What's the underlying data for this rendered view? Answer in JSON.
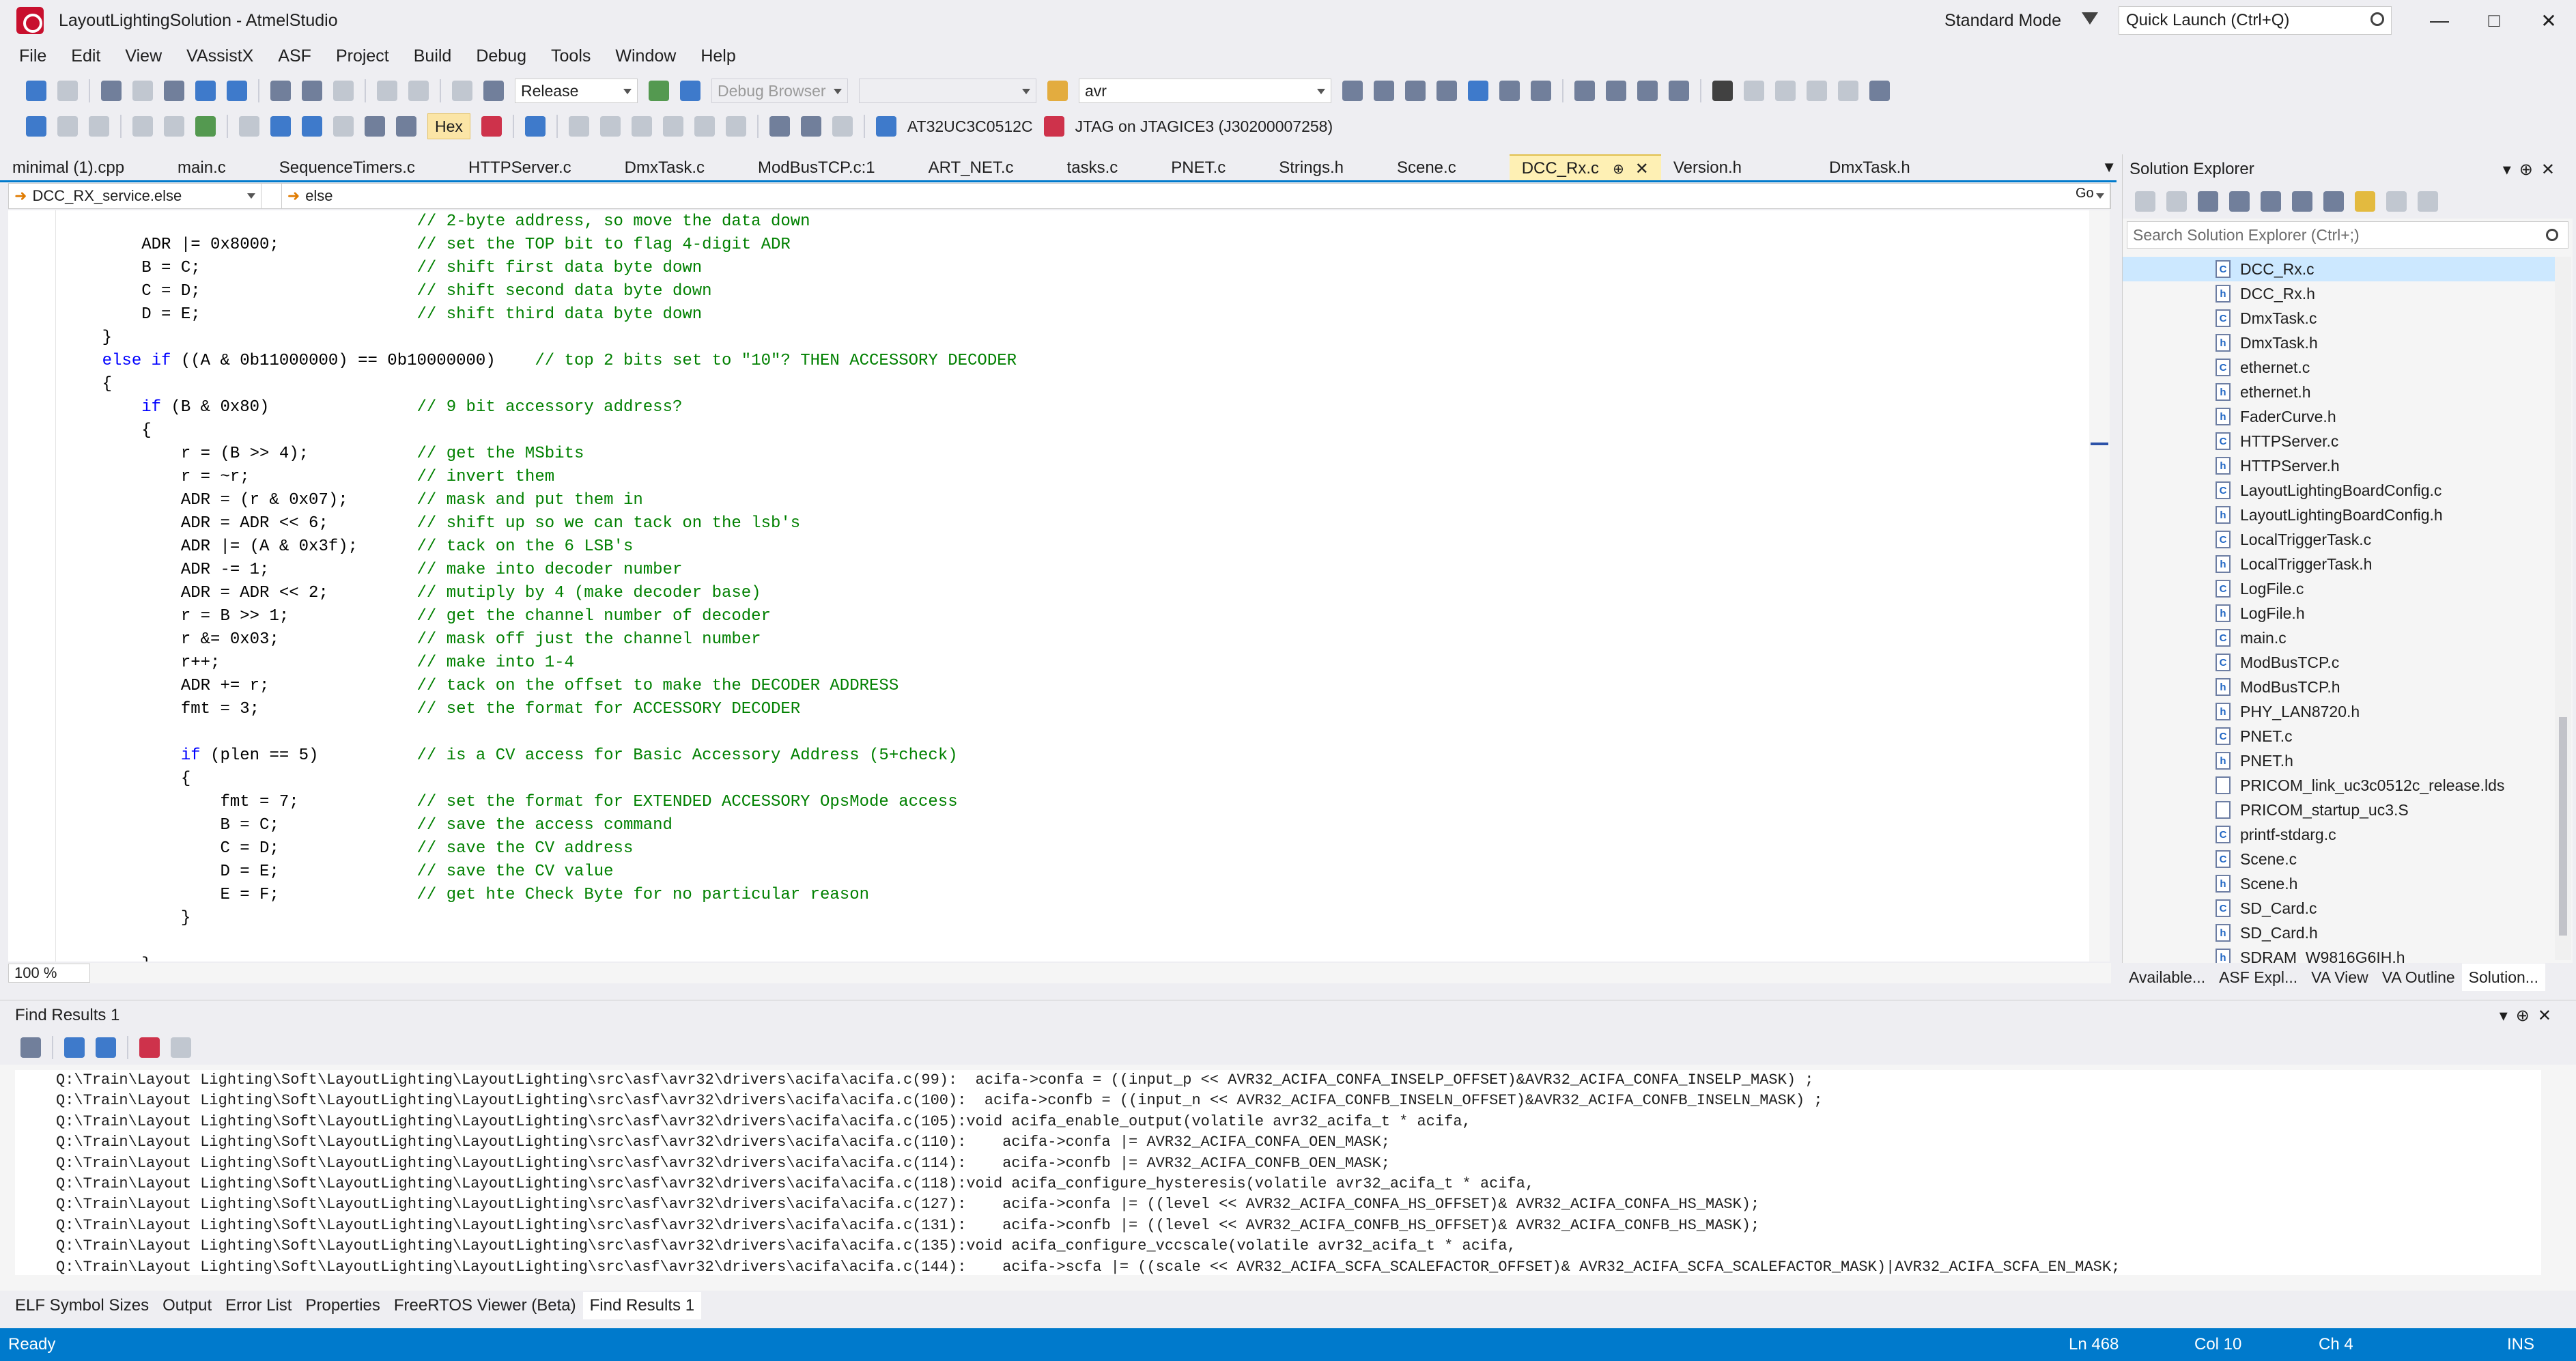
{
  "window": {
    "title": "LayoutLightingSolution - AtmelStudio",
    "mode": "Standard Mode",
    "quick_launch_placeholder": "Quick Launch (Ctrl+Q)"
  },
  "menu": [
    "File",
    "Edit",
    "View",
    "VAssistX",
    "ASF",
    "Project",
    "Build",
    "Debug",
    "Tools",
    "Window",
    "Help"
  ],
  "toolbar": {
    "config": "Release",
    "debug_browser": "Debug Browser",
    "find_combo": "avr",
    "hex": "Hex",
    "device": "AT32UC3C0512C",
    "tool": "JTAG on JTAGICE3 (J30200007258)"
  },
  "doc_tabs": [
    "minimal (1).cpp",
    "main.c",
    "SequenceTimers.c",
    "HTTPServer.c",
    "DmxTask.c",
    "ModBusTCP.c:1",
    "ART_NET.c",
    "tasks.c",
    "PNET.c",
    "Strings.h",
    "Scene.c",
    "DCC_Rx.c",
    "Version.h",
    "DmxTask.h"
  ],
  "active_tab": "DCC_Rx.c",
  "nav": {
    "scope": "DCC_RX_service.else",
    "member": "else",
    "go": "Go"
  },
  "code_lines": [
    {
      "c": "",
      "m": "// 2-byte address, so move the data down"
    },
    {
      "c": "        ADR |= 0x8000;",
      "m": "// set the TOP bit to flag 4-digit ADR"
    },
    {
      "c": "        B = C;",
      "m": "// shift first data byte down"
    },
    {
      "c": "        C = D;",
      "m": "// shift second data byte down"
    },
    {
      "c": "        D = E;",
      "m": "// shift third data byte down"
    },
    {
      "c": "    }",
      "m": ""
    },
    {
      "k": "    else if",
      "c": " ((A & 0b11000000) == 0b10000000)",
      "m": "    // top 2 bits set to \"10\"? THEN ACCESSORY DECODER"
    },
    {
      "c": "    {",
      "m": ""
    },
    {
      "k": "        if",
      "c": " (B & 0x80)",
      "m": "// 9 bit accessory address?"
    },
    {
      "c": "        {",
      "m": ""
    },
    {
      "c": "            r = (B >> 4);",
      "m": "// get the MSbits"
    },
    {
      "c": "            r = ~r;",
      "m": "// invert them"
    },
    {
      "c": "            ADR = (r & 0x07);",
      "m": "// mask and put them in"
    },
    {
      "c": "            ADR = ADR << 6;",
      "m": "// shift up so we can tack on the lsb's"
    },
    {
      "c": "            ADR |= (A & 0x3f);",
      "m": "// tack on the 6 LSB's"
    },
    {
      "c": "            ADR -= 1;",
      "m": "// make into decoder number"
    },
    {
      "c": "            ADR = ADR << 2;",
      "m": "// mutiply by 4 (make decoder base)"
    },
    {
      "c": "            r = B >> 1;",
      "m": "// get the channel number of decoder"
    },
    {
      "c": "            r &= 0x03;",
      "m": "// mask off just the channel number"
    },
    {
      "c": "            r++;",
      "m": "// make into 1-4"
    },
    {
      "c": "            ADR += r;",
      "m": "// tack on the offset to make the DECODER ADDRESS"
    },
    {
      "c": "            fmt = 3;",
      "m": "// set the format for ACCESSORY DECODER"
    },
    {
      "c": "",
      "m": ""
    },
    {
      "k": "            if",
      "c": " (plen == 5)",
      "m": "// is a CV access for Basic Accessory Address (5+check)"
    },
    {
      "c": "            {",
      "m": ""
    },
    {
      "c": "                fmt = 7;",
      "m": "// set the format for EXTENDED ACCESSORY OpsMode access"
    },
    {
      "c": "                B = C;",
      "m": "// save the access command"
    },
    {
      "c": "                C = D;",
      "m": "// save the CV address"
    },
    {
      "c": "                D = E;",
      "m": "// save the CV value"
    },
    {
      "c": "                E = F;",
      "m": "// get hte Check Byte for no particular reason"
    },
    {
      "c": "            }",
      "m": ""
    },
    {
      "c": "",
      "m": ""
    },
    {
      "c": "        }",
      "m": ""
    }
  ],
  "zoom": "100 %",
  "solution": {
    "title": "Solution Explorer",
    "search_placeholder": "Search Solution Explorer (Ctrl+;)",
    "files": [
      {
        "name": "DCC_Rx.c",
        "type": "c"
      },
      {
        "name": "DCC_Rx.h",
        "type": "h"
      },
      {
        "name": "DmxTask.c",
        "type": "c"
      },
      {
        "name": "DmxTask.h",
        "type": "h"
      },
      {
        "name": "ethernet.c",
        "type": "c"
      },
      {
        "name": "ethernet.h",
        "type": "h"
      },
      {
        "name": "FaderCurve.h",
        "type": "h"
      },
      {
        "name": "HTTPServer.c",
        "type": "c"
      },
      {
        "name": "HTTPServer.h",
        "type": "h"
      },
      {
        "name": "LayoutLightingBoardConfig.c",
        "type": "c"
      },
      {
        "name": "LayoutLightingBoardConfig.h",
        "type": "h"
      },
      {
        "name": "LocalTriggerTask.c",
        "type": "c"
      },
      {
        "name": "LocalTriggerTask.h",
        "type": "h"
      },
      {
        "name": "LogFile.c",
        "type": "c"
      },
      {
        "name": "LogFile.h",
        "type": "h"
      },
      {
        "name": "main.c",
        "type": "c"
      },
      {
        "name": "ModBusTCP.c",
        "type": "c"
      },
      {
        "name": "ModBusTCP.h",
        "type": "h"
      },
      {
        "name": "PHY_LAN8720.h",
        "type": "h"
      },
      {
        "name": "PNET.c",
        "type": "c"
      },
      {
        "name": "PNET.h",
        "type": "h"
      },
      {
        "name": "PRICOM_link_uc3c0512c_release.lds",
        "type": "f"
      },
      {
        "name": "PRICOM_startup_uc3.S",
        "type": "f"
      },
      {
        "name": "printf-stdarg.c",
        "type": "c"
      },
      {
        "name": "Scene.c",
        "type": "c"
      },
      {
        "name": "Scene.h",
        "type": "h"
      },
      {
        "name": "SD_Card.c",
        "type": "c"
      },
      {
        "name": "SD_Card.h",
        "type": "h"
      },
      {
        "name": "SDRAM_W9816G6IH.h",
        "type": "h"
      }
    ],
    "tabs": [
      "Available...",
      "ASF Expl...",
      "VA View",
      "VA Outline",
      "Solution..."
    ]
  },
  "find": {
    "title": "Find Results 1",
    "lines": [
      "Q:\\Train\\Layout Lighting\\Soft\\LayoutLighting\\LayoutLighting\\src\\asf\\avr32\\drivers\\acifa\\acifa.c(99):  acifa->confa = ((input_p << AVR32_ACIFA_CONFA_INSELP_OFFSET)&AVR32_ACIFA_CONFA_INSELP_MASK) ;",
      "Q:\\Train\\Layout Lighting\\Soft\\LayoutLighting\\LayoutLighting\\src\\asf\\avr32\\drivers\\acifa\\acifa.c(100):  acifa->confb = ((input_n << AVR32_ACIFA_CONFB_INSELN_OFFSET)&AVR32_ACIFA_CONFB_INSELN_MASK) ;",
      "Q:\\Train\\Layout Lighting\\Soft\\LayoutLighting\\LayoutLighting\\src\\asf\\avr32\\drivers\\acifa\\acifa.c(105):void acifa_enable_output(volatile avr32_acifa_t * acifa,",
      "Q:\\Train\\Layout Lighting\\Soft\\LayoutLighting\\LayoutLighting\\src\\asf\\avr32\\drivers\\acifa\\acifa.c(110):    acifa->confa |= AVR32_ACIFA_CONFA_OEN_MASK;",
      "Q:\\Train\\Layout Lighting\\Soft\\LayoutLighting\\LayoutLighting\\src\\asf\\avr32\\drivers\\acifa\\acifa.c(114):    acifa->confb |= AVR32_ACIFA_CONFB_OEN_MASK;",
      "Q:\\Train\\Layout Lighting\\Soft\\LayoutLighting\\LayoutLighting\\src\\asf\\avr32\\drivers\\acifa\\acifa.c(118):void acifa_configure_hysteresis(volatile avr32_acifa_t * acifa,",
      "Q:\\Train\\Layout Lighting\\Soft\\LayoutLighting\\LayoutLighting\\src\\asf\\avr32\\drivers\\acifa\\acifa.c(127):    acifa->confa |= ((level << AVR32_ACIFA_CONFA_HS_OFFSET)& AVR32_ACIFA_CONFA_HS_MASK);",
      "Q:\\Train\\Layout Lighting\\Soft\\LayoutLighting\\LayoutLighting\\src\\asf\\avr32\\drivers\\acifa\\acifa.c(131):    acifa->confb |= ((level << AVR32_ACIFA_CONFB_HS_OFFSET)& AVR32_ACIFA_CONFB_HS_MASK);",
      "Q:\\Train\\Layout Lighting\\Soft\\LayoutLighting\\LayoutLighting\\src\\asf\\avr32\\drivers\\acifa\\acifa.c(135):void acifa_configure_vccscale(volatile avr32_acifa_t * acifa,",
      "Q:\\Train\\Layout Lighting\\Soft\\LayoutLighting\\LayoutLighting\\src\\asf\\avr32\\drivers\\acifa\\acifa.c(144):    acifa->scfa |= ((scale << AVR32_ACIFA_SCFA_SCALEFACTOR_OFFSET)& AVR32_ACIFA_SCFA_SCALEFACTOR_MASK)|AVR32_ACIFA_SCFA_EN_MASK;"
    ]
  },
  "bottom_tabs": [
    "ELF Symbol Sizes",
    "Output",
    "Error List",
    "Properties",
    "FreeRTOS Viewer (Beta)",
    "Find Results 1"
  ],
  "status": {
    "state": "Ready",
    "ln": "Ln 468",
    "col": "Col 10",
    "ch": "Ch 4",
    "ins": "INS"
  },
  "icons": {
    "app": "atmel-studio-icon",
    "filter": "filter-icon",
    "search": "search-icon"
  },
  "colors": {
    "accent": "#007acc",
    "active_tab": "#fef0b4",
    "keyword": "#0000ff",
    "comment": "#008000"
  }
}
